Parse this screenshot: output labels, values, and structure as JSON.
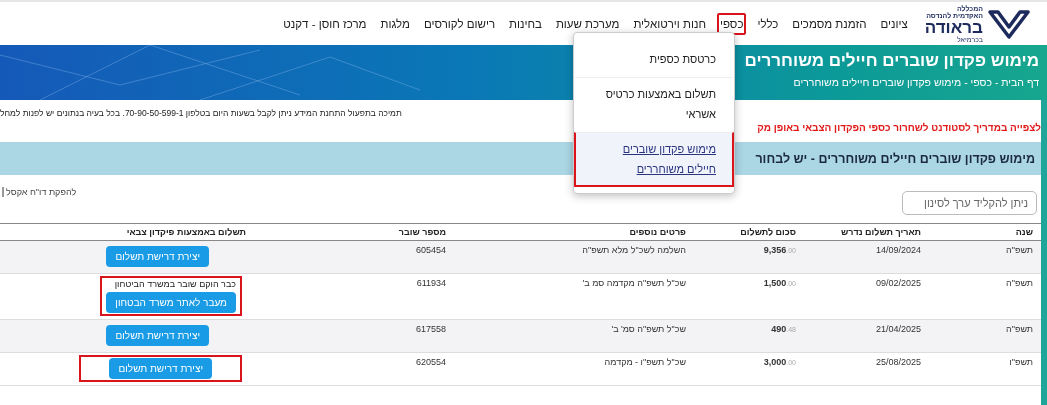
{
  "logo": {
    "line_1": "המכללה",
    "line_2": "האקדמית להנדסה",
    "name": "בראודה",
    "line_4": "בכרמיאל"
  },
  "nav": [
    {
      "label": "ציונים",
      "highlighted": false
    },
    {
      "label": "הזמנת מסמכים",
      "highlighted": false
    },
    {
      "label": "כללי",
      "highlighted": false
    },
    {
      "label": "כספי",
      "highlighted": true
    },
    {
      "label": "חנות וירטואלית",
      "highlighted": false
    },
    {
      "label": "מערכת שעות",
      "highlighted": false
    },
    {
      "label": "בחינות",
      "highlighted": false
    },
    {
      "label": "רישום לקורסים",
      "highlighted": false
    },
    {
      "label": "מלגות",
      "highlighted": false
    },
    {
      "label": "מרכז חוסן - דקנט",
      "highlighted": false
    }
  ],
  "dropdown": [
    {
      "label": "כרטסת כספית",
      "selected": false,
      "highlighted": false
    },
    {
      "label": "תשלום באמצעות כרטיס אשראי",
      "selected": false,
      "highlighted": false
    },
    {
      "label": "מימוש פקדון שוברים חיילים משוחררים",
      "selected": true,
      "highlighted": true
    }
  ],
  "banner": {
    "title": "מימוש פקדון שוברים חיילים משוחררים",
    "breadcrumb": "דף הבית  -  כספי  -  מימוש פקדון שוברים חיילים משוחררים"
  },
  "support_text": "תמיכה בתפעול התחנת המידע ניתן לקבל בשעות היום בטלפון 70-90-50-599-1. בכל בעיה בנתונים יש לפנות למחל",
  "guide_link": "לצפייה במדריך לסטודנט לשחרור כספי הפקדון הצבאי באופן מק",
  "section_title": "מימוש פקדון שוברים חיילים משוחררים - יש לבחור",
  "filter": {
    "placeholder": "ניתן להקליד ערך לסינון"
  },
  "excel_link": "להפקת דו\"ח אקסל",
  "table": {
    "columns": [
      "שנה",
      "תאריך תשלום נדרש",
      "סכום לתשלום",
      "פרטים נוספים",
      "מספר שובר",
      "תשלום באמצעות פיקדון צבאי"
    ],
    "rows": [
      {
        "year": "תשפ\"ה",
        "date": "14/09/2024",
        "amount": "9,356",
        "cents": ".00",
        "details": "השלמה לשכ\"ל מלא תשפ\"ה",
        "voucher": "605454",
        "payment": {
          "kind": "button",
          "button_label": "יצירת דרישת תשלום",
          "highlighted": false
        }
      },
      {
        "year": "תשפ\"ה",
        "date": "09/02/2025",
        "amount": "1,500",
        "cents": ".00",
        "details": "שכ\"ל תשפ\"ה מקדמה סמ ב'",
        "voucher": "611934",
        "payment": {
          "kind": "issued",
          "note": "כבר הוקם שובר במשרד הביטחון",
          "button_label": "מעבר לאתר משרד הבטחון",
          "highlighted": true
        }
      },
      {
        "year": "תשפ\"ה",
        "date": "21/04/2025",
        "amount": "490",
        "cents": ".48",
        "details": "שכ\"ל תשפ\"ה סמ' ב'",
        "voucher": "617558",
        "payment": {
          "kind": "button",
          "button_label": "יצירת דרישת תשלום",
          "highlighted": false
        }
      },
      {
        "year": "תשפ\"ו",
        "date": "25/08/2025",
        "amount": "3,000",
        "cents": ".00",
        "details": "שכ\"ל תשפ\"ו - מקדמה",
        "voucher": "620554",
        "payment": {
          "kind": "button",
          "button_label": "יצירת דרישת תשלום",
          "highlighted": true
        }
      }
    ]
  }
}
